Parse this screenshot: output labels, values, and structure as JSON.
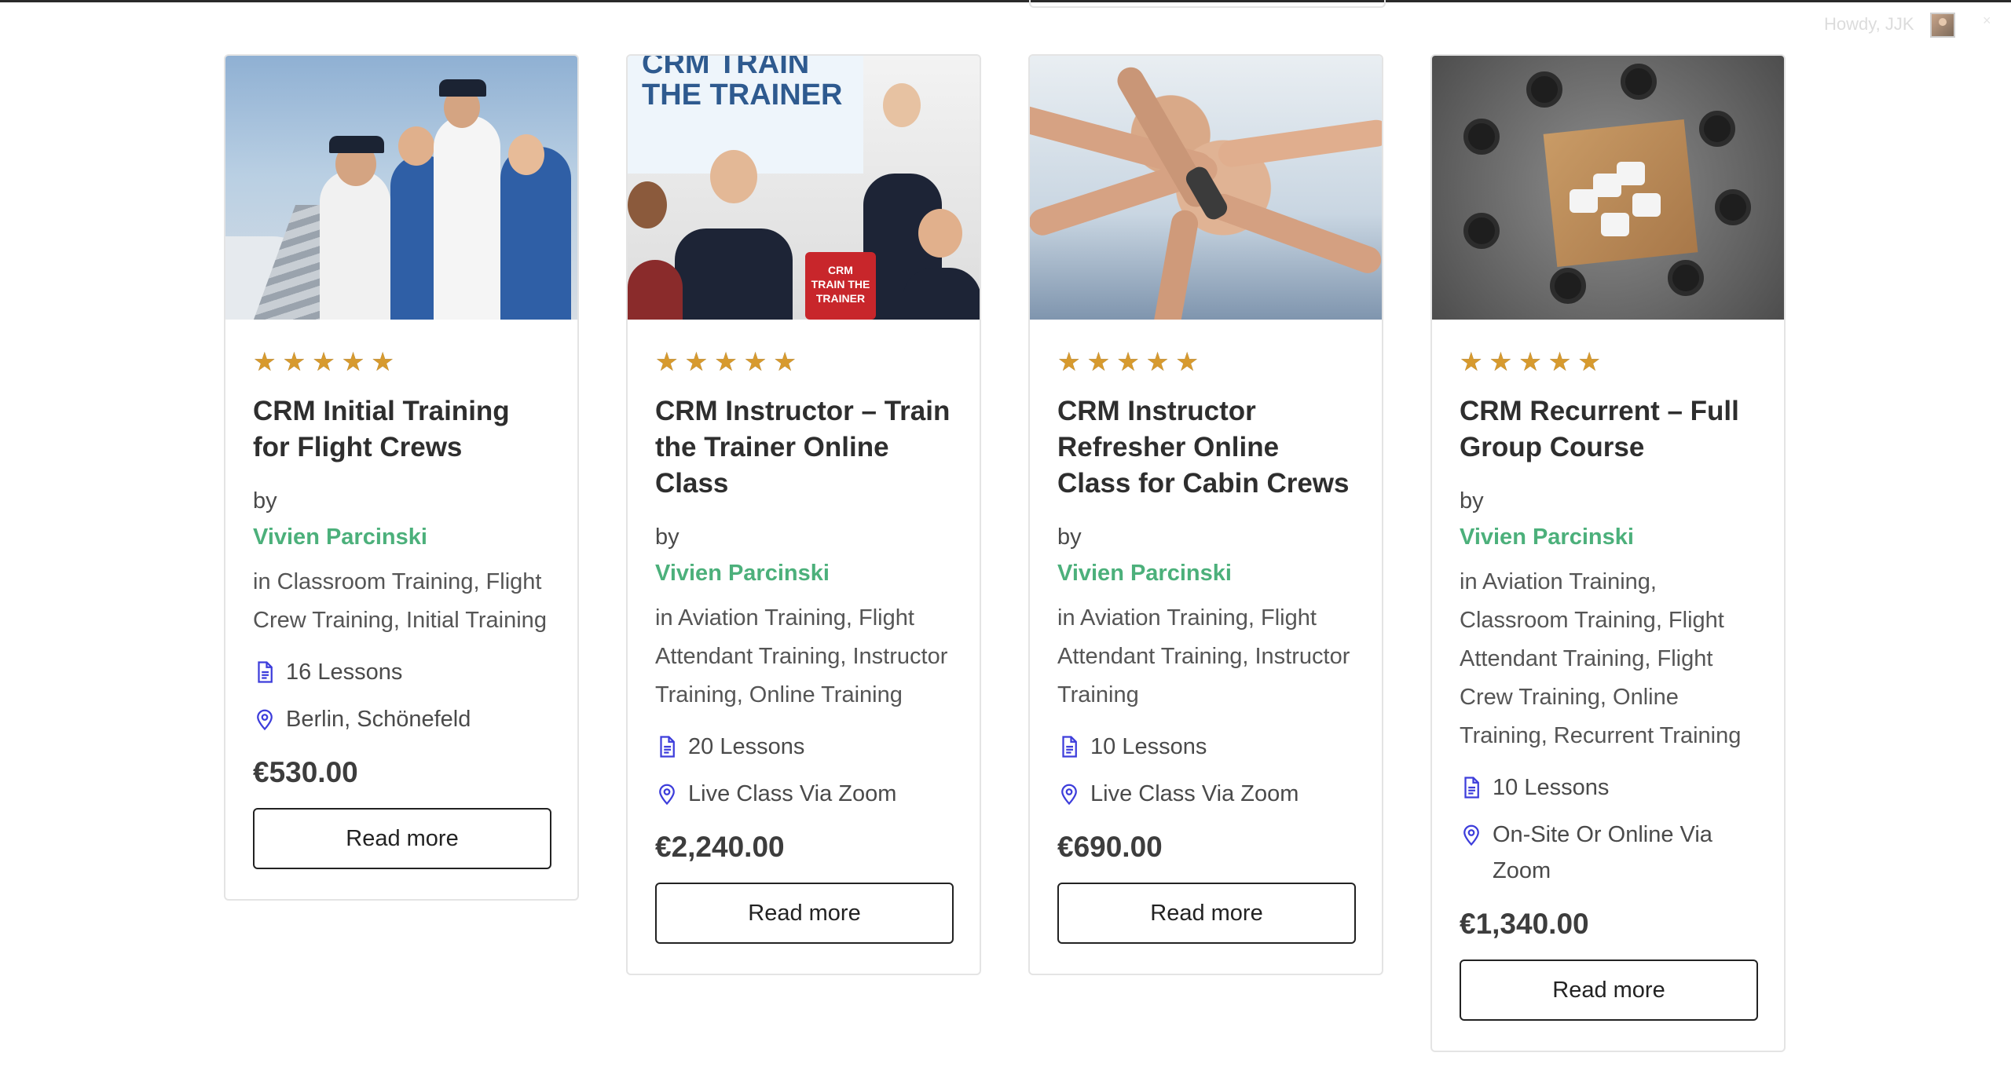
{
  "header": {
    "greeting": "Howdy, JJK"
  },
  "cards": [
    {
      "title": "CRM Initial Training for Flight Crews",
      "by": "by",
      "author": "Vivien Parcinski",
      "categories": "in Classroom Training, Flight Crew Training, Initial Training",
      "lessons": "16 Lessons",
      "location": "Berlin, Schönefeld",
      "price": "€530.00",
      "button": "Read more",
      "rating": 5
    },
    {
      "title": "CRM Instructor – Train the Trainer Online Class",
      "by": "by",
      "author": "Vivien Parcinski",
      "categories": "in Aviation Training, Flight Attendant Training, Instructor Training, Online Training",
      "lessons": "20 Lessons",
      "location": "Live Class Via Zoom",
      "price": "€2,240.00",
      "button": "Read more",
      "rating": 5,
      "image_text": "CRM TRAIN THE TRAINER",
      "case_text": "CRM TRAIN THE TRAINER"
    },
    {
      "title": "CRM Instructor Refresher Online Class for Cabin Crews",
      "by": "by",
      "author": "Vivien Parcinski",
      "categories": "in Aviation Training, Flight Attendant Training, Instructor Training",
      "lessons": "10 Lessons",
      "location": "Live Class Via Zoom",
      "price": "€690.00",
      "button": "Read more",
      "rating": 5
    },
    {
      "title": "CRM Recurrent – Full Group Course",
      "by": "by",
      "author": "Vivien Parcinski",
      "categories": "in Aviation Training, Classroom Training, Flight Attendant Training, Flight Crew Training, Online Training, Recurrent Training",
      "lessons": "10 Lessons",
      "location": "On-Site Or Online Via Zoom",
      "price": "€1,340.00",
      "button": "Read more",
      "rating": 5
    }
  ],
  "icons": {
    "star": "star-icon",
    "lessons": "document-icon",
    "location": "map-pin-icon"
  },
  "colors": {
    "author": "#4cb07b",
    "star": "#d79a2e",
    "meta_icon": "#3d3ddb",
    "button_border": "#222222"
  }
}
